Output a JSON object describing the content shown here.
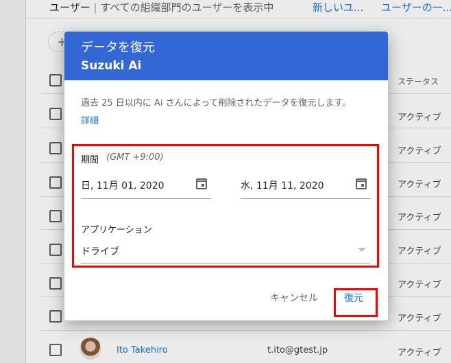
{
  "header": {
    "title": "ユーザー",
    "separator": "|",
    "subtitle": "すべての組織部門のユーザーを表示中",
    "link_new": "新しいユ...",
    "link_more": "ユーザーの一..."
  },
  "table": {
    "add_filter_label": "+",
    "status_header": "ステータス",
    "rows": [
      {
        "status": "アクティブ"
      },
      {
        "status": "アクティブ"
      },
      {
        "status": "アクティブ"
      },
      {
        "status": "アクティブ"
      },
      {
        "status": "アクティブ"
      },
      {
        "status": "アクティブ"
      },
      {
        "status": "アクティブ"
      },
      {
        "name": "Ito Takehiro",
        "email": "t.ito@gtest.jp",
        "status": "アクティブ"
      }
    ]
  },
  "dialog": {
    "title": "データを復元",
    "subtitle": "Suzuki Ai",
    "description": "過去 25 日以内に Ai さんによって削除されたデータを復元します。",
    "details_link": "詳細",
    "period_label": "期間",
    "period_tz": "(GMT +9:00)",
    "start_date": "日, 11月 01, 2020",
    "end_date": "水, 11月 11, 2020",
    "app_label": "アプリケーション",
    "app_value": "ドライブ",
    "cancel_label": "キャンセル",
    "restore_label": "復元"
  },
  "icons": {
    "calendar": "calendar-icon",
    "dropdown": "dropdown-arrow-icon"
  },
  "colors": {
    "header_bg": "#3367d6",
    "link": "#1a73e8",
    "highlight": "#ff0000"
  }
}
